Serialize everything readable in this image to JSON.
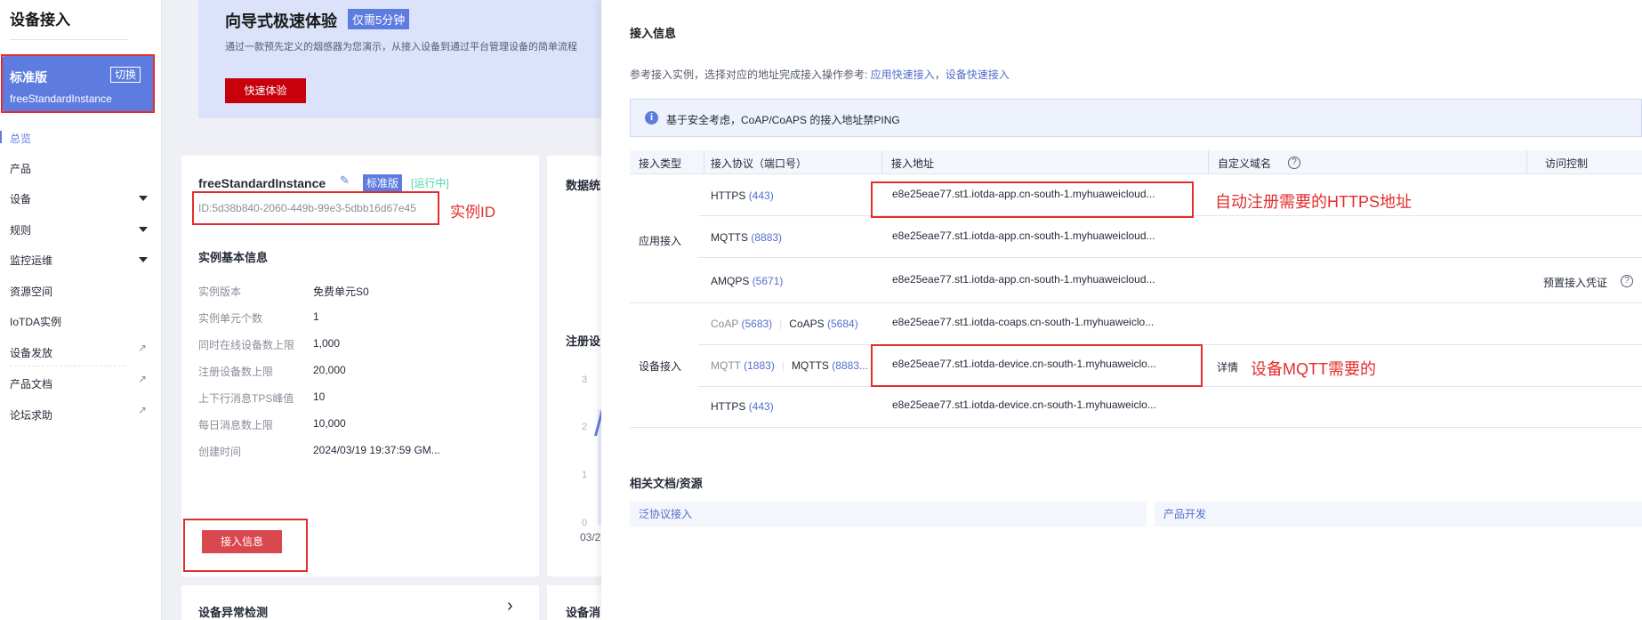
{
  "sidebar": {
    "title": "设备接入",
    "instance": {
      "edition": "标准版",
      "switch_label": "切换",
      "name": "freeStandardInstance"
    },
    "items": [
      {
        "label": "总览"
      },
      {
        "label": "产品"
      },
      {
        "label": "设备"
      },
      {
        "label": "规则"
      },
      {
        "label": "监控运维"
      },
      {
        "label": "资源空间"
      },
      {
        "label": "IoTDA实例"
      },
      {
        "label": "设备发放"
      },
      {
        "label": "产品文档"
      },
      {
        "label": "论坛求助"
      }
    ]
  },
  "banner": {
    "title": "向导式极速体验",
    "badge": "仅需5分钟",
    "description": "通过一款预先定义的烟感器为您演示，从接入设备到通过平台管理设备的简单流程",
    "button": "快速体验"
  },
  "instance_panel": {
    "name": "freeStandardInstance",
    "edition_badge": "标准版",
    "status": "[运行中]",
    "id": "ID:5d38b840-2060-449b-99e3-5dbb16d67e45",
    "annotation": "实例ID",
    "basic_title": "实例基本信息",
    "rows": [
      {
        "label": "实例版本",
        "value": "免费单元S0"
      },
      {
        "label": "实例单元个数",
        "value": "1"
      },
      {
        "label": "同时在线设备数上限",
        "value": "1,000"
      },
      {
        "label": "注册设备数上限",
        "value": "20,000"
      },
      {
        "label": "上下行消息TPS峰值",
        "value": "10"
      },
      {
        "label": "每日消息数上限",
        "value": "10,000"
      },
      {
        "label": "创建时间",
        "value": "2024/03/19 19:37:59 GM..."
      }
    ],
    "access_button": "接入信息"
  },
  "data_card": {
    "title": "数据统"
  },
  "register_card": {
    "title": "注册设",
    "ticks": [
      "3",
      "2",
      "1",
      "0"
    ],
    "xlabel": "03/2"
  },
  "abnormal_card": {
    "title": "设备异常检测",
    "arrow": "›"
  },
  "message_card": {
    "title": "设备消"
  },
  "drawer": {
    "title": "接入信息",
    "ref_prefix": "参考接入实例，选择对应的地址完成接入操作参考: ",
    "ref_link1": "应用快速接入",
    "ref_sep": "，",
    "ref_link2": "设备快速接入",
    "info": "基于安全考虑，CoAP/CoAPS 的接入地址禁PING",
    "columns": [
      "接入类型",
      "接入协议（端口号）",
      "接入地址",
      "自定义域名",
      "访问控制"
    ],
    "groups": {
      "app": "应用接入",
      "device": "设备接入"
    },
    "rows": {
      "app_https": {
        "proto": "HTTPS",
        "port": "(443)",
        "address": "e8e25eae77.st1.iotda-app.cn-south-1.myhuaweicloud..."
      },
      "app_mqtts": {
        "proto": "MQTTS",
        "port": "(8883)",
        "address": "e8e25eae77.st1.iotda-app.cn-south-1.myhuaweicloud..."
      },
      "app_amqps": {
        "proto": "AMQPS",
        "port": "(5671)",
        "address": "e8e25eae77.st1.iotda-app.cn-south-1.myhuaweicloud...",
        "access": "预置接入凭证"
      },
      "dev_coap": {
        "proto": "CoAP",
        "port": "(5683)",
        "proto2": "CoAPS",
        "port2": "(5684)",
        "address": "e8e25eae77.st1.iotda-coaps.cn-south-1.myhuaweiclo..."
      },
      "dev_mqtt": {
        "proto": "MQTT",
        "port": "(1883)",
        "proto2": "MQTTS",
        "port2": "(8883...",
        "address": "e8e25eae77.st1.iotda-device.cn-south-1.myhuaweiclo...",
        "detail": "详情"
      },
      "dev_https": {
        "proto": "HTTPS",
        "port": "(443)",
        "address": "e8e25eae77.st1.iotda-device.cn-south-1.myhuaweiclo..."
      }
    },
    "annotation_https": "自动注册需要的HTTPS地址",
    "annotation_mqtt": "设备MQTT需要的",
    "docs_title": "相关文档/资源",
    "docs": [
      "泛协议接入",
      "产品开发"
    ]
  },
  "colors": {
    "accent": "#5e7ce0",
    "annotation_red": "#e32d2d",
    "brand_red": "#c7000b"
  }
}
